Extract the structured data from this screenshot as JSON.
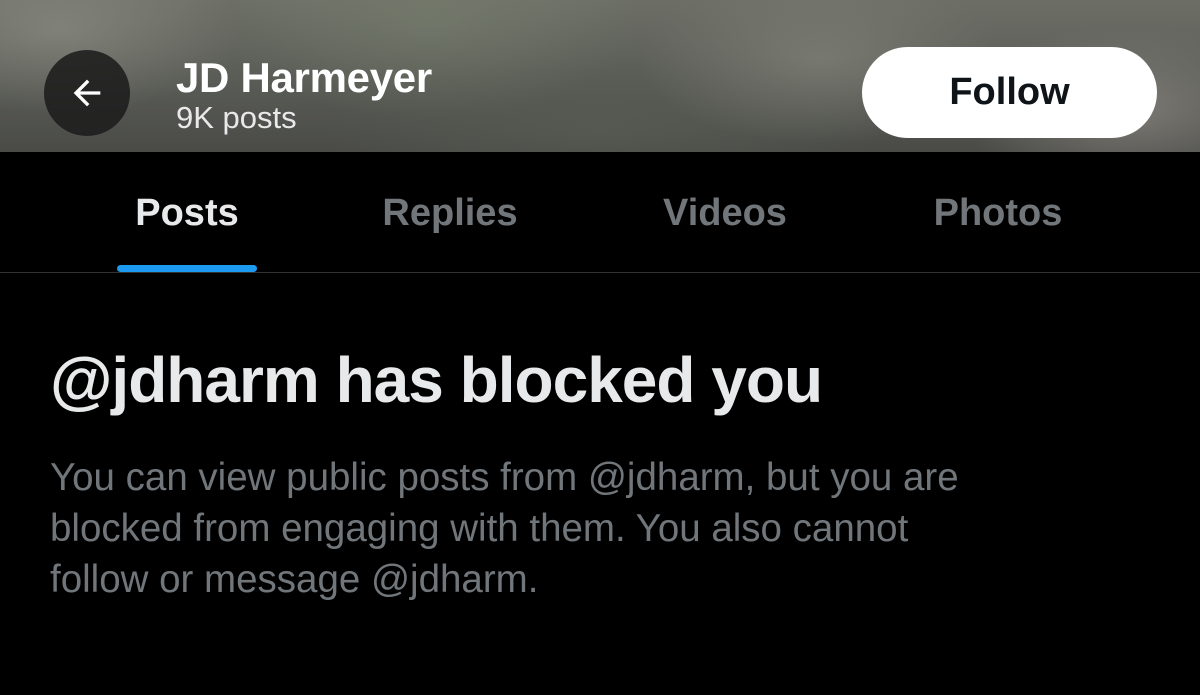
{
  "header": {
    "back_icon": "arrow-left-icon",
    "name": "JD Harmeyer",
    "post_count": "9K posts",
    "follow_label": "Follow"
  },
  "tabs": [
    {
      "label": "Posts",
      "active": true
    },
    {
      "label": "Replies",
      "active": false
    },
    {
      "label": "Videos",
      "active": false
    },
    {
      "label": "Photos",
      "active": false
    }
  ],
  "blocked": {
    "title": "@jdharm has blocked you",
    "body_lines": [
      "You can view public posts from @jdharm, but you are",
      "blocked from engaging with them. You also cannot",
      "follow or message @jdharm."
    ]
  },
  "colors": {
    "background": "#000000",
    "accent": "#1d9bf0",
    "primary_text": "#e7e9ea",
    "secondary_text": "#71767b",
    "follow_button_bg": "#ffffff"
  }
}
